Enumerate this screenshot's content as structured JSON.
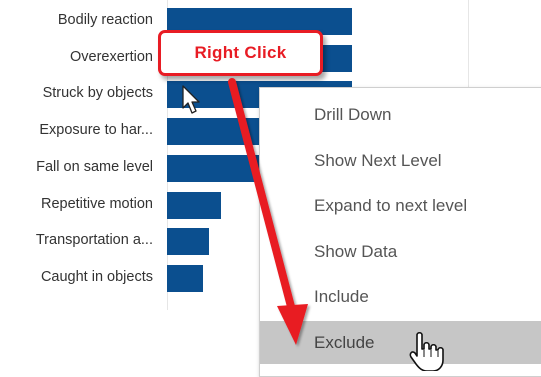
{
  "chart_data": {
    "type": "bar",
    "orientation": "horizontal",
    "categories": [
      "Bodily reaction",
      "Overexertion",
      "Struck by objects",
      "Exposure to har...",
      "Fall on same level",
      "Repetitive motion",
      "Transportation a...",
      "Caught in objects"
    ],
    "values": [
      185,
      185,
      185,
      185,
      185,
      54,
      42,
      36
    ],
    "xlim": [
      0,
      200
    ],
    "bar_color": "#0b4f8f",
    "grid": false
  },
  "callout": {
    "label": "Right Click",
    "color": "#e81c24"
  },
  "context_menu": {
    "items": [
      {
        "label": "Drill Down",
        "highlighted": false
      },
      {
        "label": "Show Next Level",
        "highlighted": false
      },
      {
        "label": "Expand to next level",
        "highlighted": false
      },
      {
        "label": "Show Data",
        "highlighted": false
      },
      {
        "label": "Include",
        "highlighted": false
      },
      {
        "label": "Exclude",
        "highlighted": true
      }
    ]
  },
  "colors": {
    "accent": "#e81c24",
    "menu_highlight": "#c6c6c6",
    "bar": "#0b4f8f"
  },
  "icons": {
    "pointer": "arrow-cursor-icon",
    "hand": "hand-cursor-icon"
  }
}
